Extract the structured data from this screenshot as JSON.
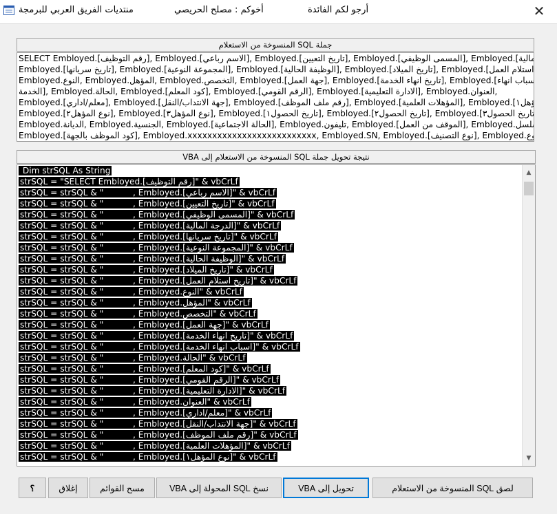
{
  "window": {
    "title_left": "منتديات الفريق العربي للبرمجة",
    "title_mid": "أخوكم : مصلح الحريصي",
    "title_right": "أرجو لكم الفائدة",
    "close_glyph": "✕"
  },
  "sql_section": {
    "label": "جملة SQL المنسوخة من الاستعلام",
    "lines": [
      "SELECT Embloyed.[رقم التوظيف], Embloyed.[الاسم رباعي], Embloyed.[تاريخ التعيين], Embloyed.[المسمى الوظيفي], Embloyed.[الدرجة المالية],",
      " Embloyed.[تاريخ سريانها], Embloyed.[المجموعة النوعية], Embloyed.[الوظيفة الحالية], Embloyed.[تاريخ الميلاد], Embloyed.[تاريخ استلام العمل],",
      "Embloyed.النوع, Embloyed.المؤهل, Embloyed.التخصص, Embloyed.[جهة العمل], Embloyed.[تاريخ انهاء الخدمة], Embloyed.[اسباب انهاء",
      "الخدمة], Embloyed.الحالة, Embloyed.[كود المعلم], Embloyed.[الرقم القومي], Embloyed.[الادارة التعليمية], Embloyed.العنوان,",
      "Embloyed.[معلم/اداري], Embloyed.[جهة الانتداب/النقل], Embloyed.[رقم ملف الموظف], Embloyed.[المؤهلات العلمية], Embloyed.[نوع المؤهل١],",
      "Embloyed.[نوع المؤهل٢], Embloyed.[نوع المؤهل٣], Embloyed.[تاريخ الحصول١], Embloyed.[تاريخ الحصول٢], Embloyed.[تاريخ الحصول٣],",
      "Embloyed.الديانة, Embloyed.الجنسية, Embloyed.[الحالة الاجتماعية], Embloyed.تليفون, Embloyed.[الموقف من العمل], Embloyed.مسلسل,",
      "Embloyed.[كود الموظف بالجهة], Embloyed.xxxxxxxxxxxxxxxxxxxxxxxxxx, Embloyed.SN, Embloyed.[نوع التصنيف], Embloyed.نوع"
    ]
  },
  "vba_section": {
    "label": "نتيجة تحويل جملة SQL المنسوخة من الاستعلام  إلى VBA",
    "lines": [
      " Dim strSQL As String",
      "strSQL = \"SELECT Embloyed.[رقم التوظيف]\" & vbCrLf",
      "strSQL = strSQL & \"           , Embloyed.[الاسم رباعي]\" & vbCrLf",
      "strSQL = strSQL & \"           , Embloyed.[تاريخ التعيين]\" & vbCrLf",
      "strSQL = strSQL & \"           , Embloyed.[المسمى الوظيفي]\" & vbCrLf",
      "strSQL = strSQL & \"           , Embloyed.[الدرجة المالية]\" & vbCrLf",
      "strSQL = strSQL & \"           , Embloyed.[تاريخ سريانها]\" & vbCrLf",
      "strSQL = strSQL & \"           , Embloyed.[المجموعة النوعية]\" & vbCrLf",
      "strSQL = strSQL & \"           , Embloyed.[الوظيفة الحالية]\" & vbCrLf",
      "strSQL = strSQL & \"           , Embloyed.[تاريخ الميلاد]\" & vbCrLf",
      "strSQL = strSQL & \"           , Embloyed.[تاريخ استلام العمل]\" & vbCrLf",
      "strSQL = strSQL & \"           , Embloyed.النوع\" & vbCrLf",
      "strSQL = strSQL & \"           , Embloyed.المؤهل\" & vbCrLf",
      "strSQL = strSQL & \"           , Embloyed.التخصص\" & vbCrLf",
      "strSQL = strSQL & \"           , Embloyed.[جهة العمل]\" & vbCrLf",
      "strSQL = strSQL & \"           , Embloyed.[تاريخ انهاء الخدمة]\" & vbCrLf",
      "strSQL = strSQL & \"           , Embloyed.[اسباب انهاء الخدمة]\" & vbCrLf",
      "strSQL = strSQL & \"           , Embloyed.الحالة\" & vbCrLf",
      "strSQL = strSQL & \"           , Embloyed.[كود المعلم]\" & vbCrLf",
      "strSQL = strSQL & \"           , Embloyed.[الرقم القومي]\" & vbCrLf",
      "strSQL = strSQL & \"           , Embloyed.[الادارة التعليمية]\" & vbCrLf",
      "strSQL = strSQL & \"           , Embloyed.العنوان\" & vbCrLf",
      "strSQL = strSQL & \"           , Embloyed.[معلم/اداري]\" & vbCrLf",
      "strSQL = strSQL & \"           , Embloyed.[جهة الانتداب/النقل]\" & vbCrLf",
      "strSQL = strSQL & \"           , Embloyed.[رقم ملف الموظف]\" & vbCrLf",
      "strSQL = strSQL & \"           , Embloyed.[المؤهلات العلمية]\" & vbCrLf",
      "strSQL = strSQL & \"           , Embloyed.[نوع المؤهل١]\" & vbCrLf"
    ]
  },
  "buttons": {
    "paste": "لصق SQL المنسوخة من الاستعلام",
    "convert": "تحويل إلى VBA",
    "copy": "نسخ SQL المحولة إلى VBA",
    "clear": "مسح القوائم",
    "close": "إغلاق",
    "help": "؟"
  }
}
